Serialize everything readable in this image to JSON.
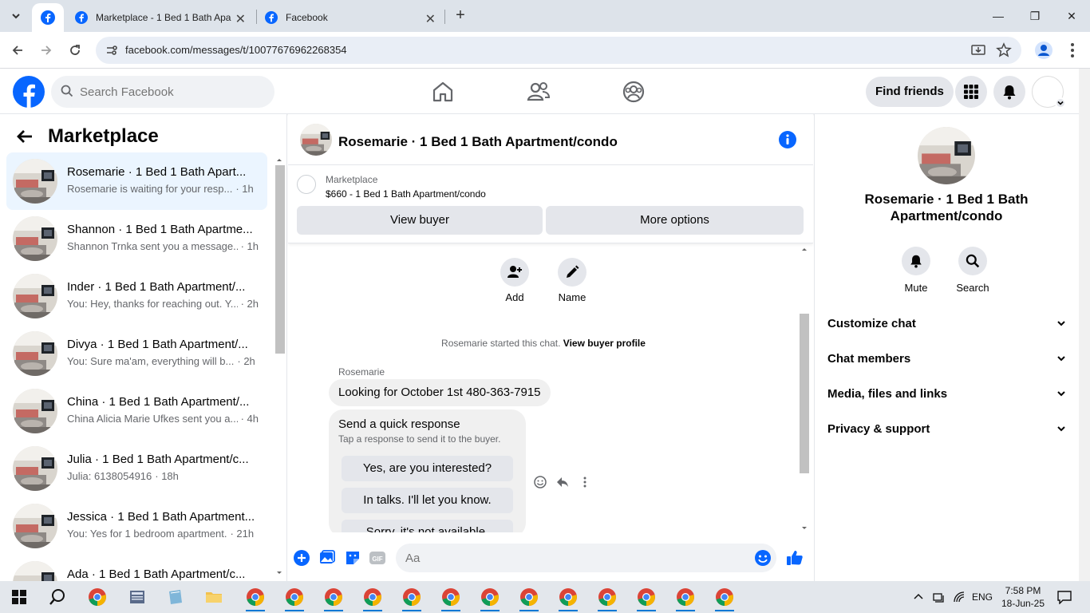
{
  "browser": {
    "tabs": [
      {
        "title": "Marketplace - 1 Bed 1 Bath Apa",
        "close": "✕"
      },
      {
        "title": "Facebook",
        "close": "✕"
      }
    ],
    "new_tab": "+",
    "url": "facebook.com/messages/t/10077676962268354",
    "controls": {
      "minimize": "—",
      "restore": "❐",
      "close": "✕"
    }
  },
  "fb_header": {
    "search_placeholder": "Search Facebook",
    "find_friends": "Find friends"
  },
  "left": {
    "title": "Marketplace",
    "conversations": [
      {
        "title": "Rosemarie · 1 Bed 1 Bath Apart...",
        "snippet": "Rosemarie is waiting for your resp...",
        "time": "· 1h",
        "active": true
      },
      {
        "title": "Shannon · 1 Bed 1 Bath Apartme...",
        "snippet": "Shannon Trnka sent you a message...",
        "time": "· 1h"
      },
      {
        "title": "Inder · 1 Bed 1 Bath Apartment/...",
        "snippet": "You: Hey, thanks for reaching out. Y...",
        "time": "· 2h"
      },
      {
        "title": "Divya · 1 Bed 1 Bath Apartment/...",
        "snippet": "You: Sure ma'am, everything will b...",
        "time": "· 2h"
      },
      {
        "title": "China · 1 Bed 1 Bath Apartment/...",
        "snippet": "China Alicia Marie Ufkes sent you a...",
        "time": "· 4h"
      },
      {
        "title": "Julia · 1 Bed 1 Bath Apartment/c...",
        "snippet": "Julia: 6138054916",
        "time": "· 18h"
      },
      {
        "title": "Jessica · 1 Bed 1 Bath Apartment...",
        "snippet": "You: Yes for 1 bedroom apartment.",
        "time": "· 21h"
      },
      {
        "title": "Ada · 1 Bed 1 Bath Apartment/c...",
        "snippet": "",
        "time": ""
      }
    ]
  },
  "chat": {
    "header_name": "Rosemarie · 1 Bed 1 Bath Apartment/condo",
    "marketplace_label": "Marketplace",
    "listing": "$660 - 1 Bed 1 Bath Apartment/condo",
    "view_buyer": "View buyer",
    "more_options": "More options",
    "actions": [
      {
        "label": "Add"
      },
      {
        "label": "Name"
      }
    ],
    "started_text": "Rosemarie started this chat.",
    "view_buyer_profile": "View buyer profile",
    "sender": "Rosemarie",
    "message": "Looking for October 1st 480-363-7915",
    "quick": {
      "title": "Send a quick response",
      "subtitle": "Tap a response to send it to the buyer.",
      "options": [
        "Yes, are you interested?",
        "In talks. I'll let you know.",
        "Sorry, it's not available."
      ]
    },
    "composer_placeholder": "Aa"
  },
  "right": {
    "name": "Rosemarie · 1 Bed 1 Bath Apartment/condo",
    "mute": "Mute",
    "search": "Search",
    "sections": [
      "Customize chat",
      "Chat members",
      "Media, files and links",
      "Privacy & support"
    ]
  },
  "taskbar": {
    "lang": "ENG",
    "time": "7:58 PM",
    "date": "18-Jun-25"
  },
  "colors": {
    "fb_blue": "#0866ff",
    "active_conv": "#ebf5ff"
  }
}
